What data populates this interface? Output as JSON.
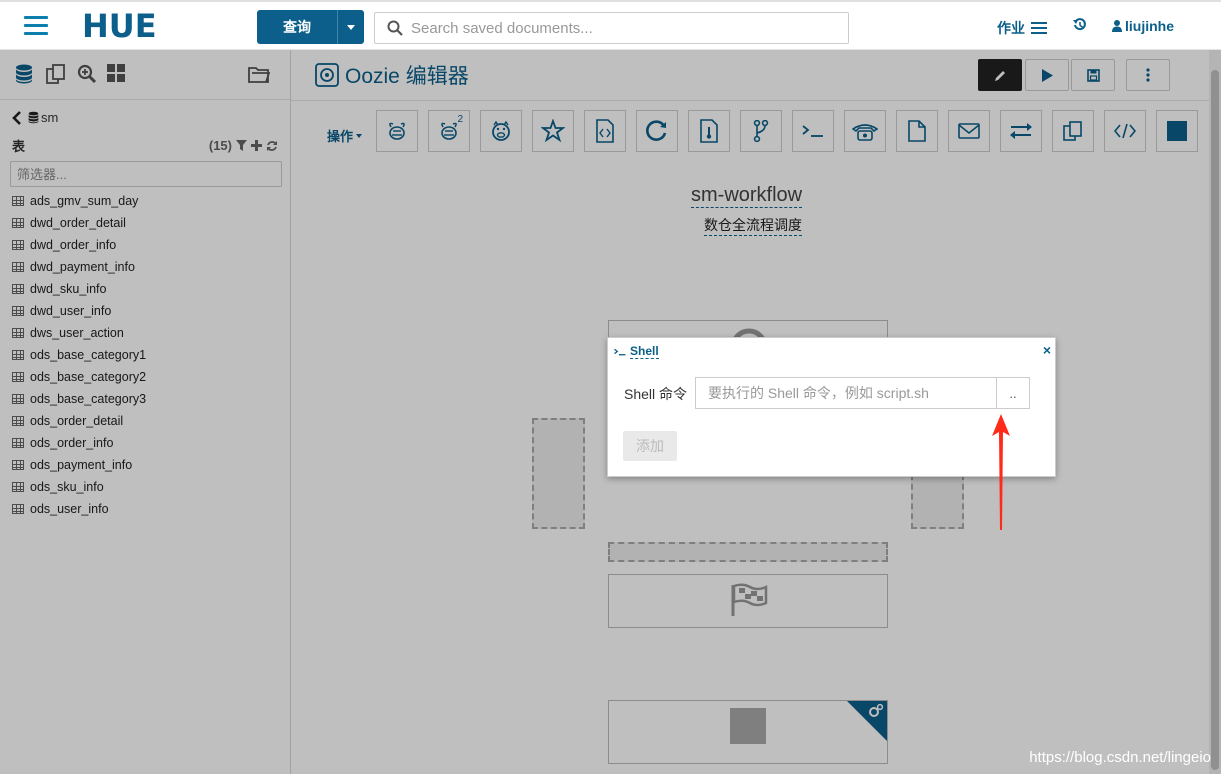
{
  "topbar": {
    "logo_text": "HUE",
    "query_label": "查询",
    "search_placeholder": "Search saved documents...",
    "jobs_label": "作业",
    "user_name": "liujinhe"
  },
  "sidebar": {
    "database": "sm",
    "tables_label": "表",
    "tables_count": "(15)",
    "filter_placeholder": "筛选器...",
    "tables": [
      "ads_gmv_sum_day",
      "dwd_order_detail",
      "dwd_order_info",
      "dwd_payment_info",
      "dwd_sku_info",
      "dwd_user_info",
      "dws_user_action",
      "ods_base_category1",
      "ods_base_category2",
      "ods_base_category3",
      "ods_order_detail",
      "ods_order_info",
      "ods_payment_info",
      "ods_sku_info",
      "ods_user_info"
    ]
  },
  "editor": {
    "title": "Oozie 编辑器",
    "actions_label": "操作",
    "hive2_sup": "2",
    "workflow_name": "sm-workflow",
    "workflow_desc": "数仓全流程调度"
  },
  "dialog": {
    "title": "Shell",
    "close_glyph": "×",
    "field_label": "Shell 命令",
    "field_placeholder": "要执行的 Shell 命令，例如 script.sh",
    "browse_label": "..",
    "add_label": "添加"
  },
  "watermark": "https://blog.csdn.net/lingeio",
  "colors": {
    "brand": "#0b5f8a",
    "arrow": "#ff2a1a"
  }
}
